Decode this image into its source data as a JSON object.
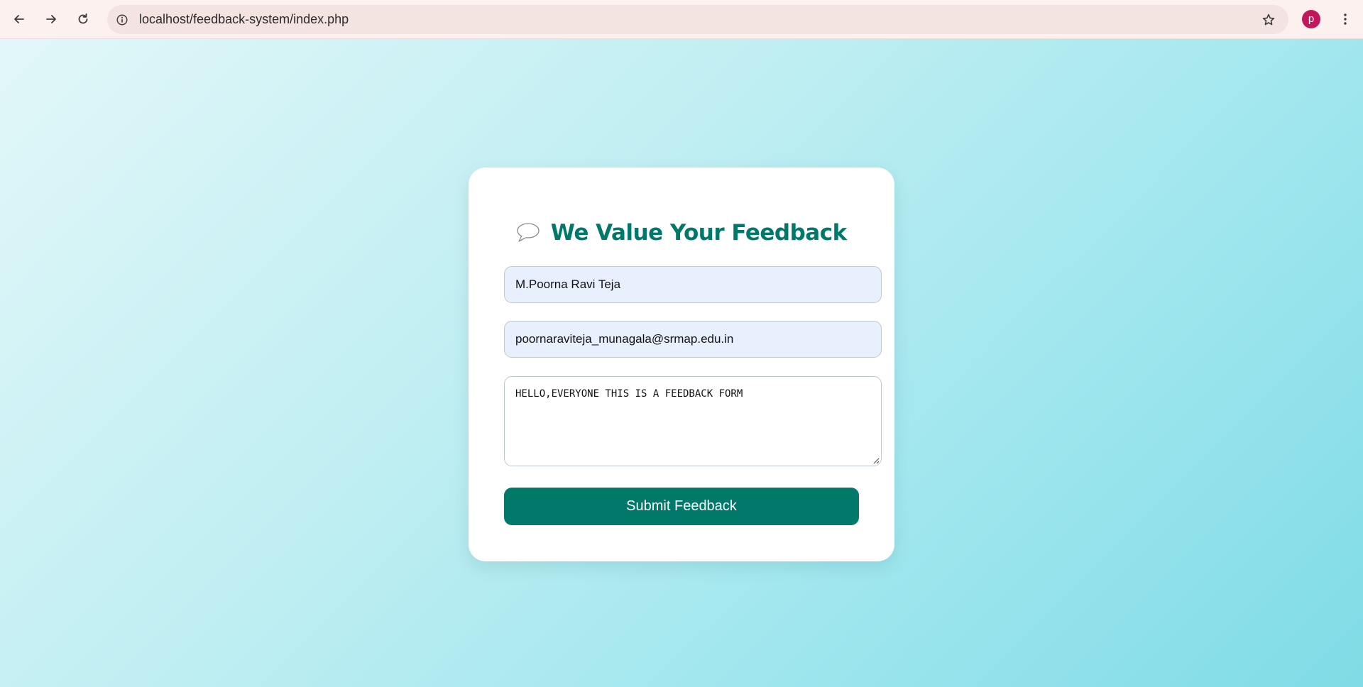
{
  "browser": {
    "url": "localhost/feedback-system/index.php",
    "profile_initial": "p",
    "icons": {
      "back": "arrow-left-icon",
      "forward": "arrow-right-icon",
      "reload": "reload-icon",
      "site_info": "info-icon",
      "bookmark": "star-icon",
      "menu": "kebab-menu-icon"
    },
    "colors": {
      "toolbar": "#fdf1ef",
      "omnibox": "#f3e4e2",
      "avatar": "#c2185b"
    }
  },
  "page": {
    "title": "We Value Your Feedback",
    "title_icon": "speech-bubble-icon",
    "form": {
      "name_value": "M.Poorna Ravi Teja",
      "email_value": "poornaraviteja_munagala@srmap.edu.in",
      "message_value": "HELLO,EVERYONE THIS IS A FEEDBACK FORM",
      "submit_label": "Submit Feedback"
    },
    "colors": {
      "accent": "#00796b",
      "autofill_bg": "#e8f0fe",
      "background_start": "#e2f7f9",
      "background_end": "#7fdbe6"
    }
  }
}
